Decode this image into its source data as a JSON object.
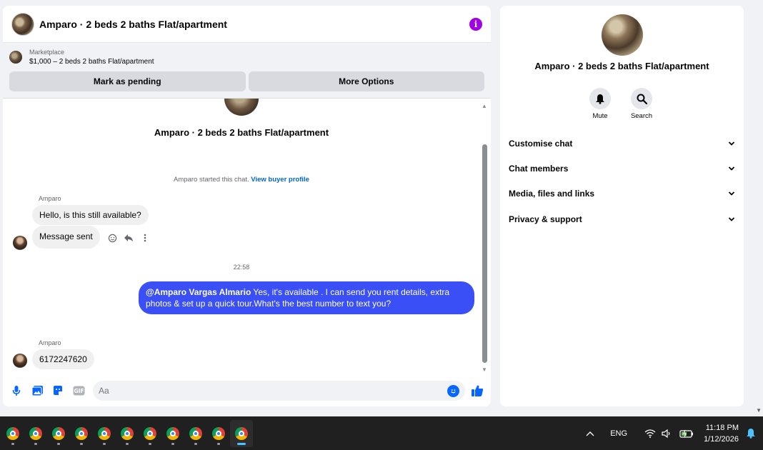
{
  "chat": {
    "title": "Amparo · 2 beds 2 baths Flat/apartment",
    "listing": {
      "label": "Marketplace",
      "detail": "$1,000 – 2 beds 2 baths Flat/apartment",
      "mark_pending": "Mark as pending",
      "more_options": "More Options"
    },
    "thread_name": "Amparo · 2 beds 2 baths Flat/apartment",
    "started_text": "Amparo started this chat.",
    "view_profile": "View buyer profile",
    "messages": [
      {
        "sender": "Amparo",
        "text": "Hello, is this still available?"
      },
      {
        "text": "Message sent"
      },
      {
        "timestamp": "22:58"
      },
      {
        "mention": "@Amparo Vargas Almario",
        "text": " Yes, it's available .  I can send you rent details, extra photos & set up a quick tour.What's the best number to text you?"
      },
      {
        "sender": "Amparo",
        "text": "6172247620"
      }
    ],
    "composer": {
      "placeholder": "Aa"
    }
  },
  "info_panel": {
    "name": "Amparo · 2 beds 2 baths Flat/apartment",
    "actions": [
      {
        "label": "Mute",
        "icon": "bell-icon"
      },
      {
        "label": "Search",
        "icon": "search-icon"
      }
    ],
    "sections": [
      "Customise chat",
      "Chat members",
      "Media, files and links",
      "Privacy & support"
    ]
  },
  "taskbar": {
    "app_count": 11,
    "language": "ENG",
    "time": "11:18 PM",
    "date": "1/12/2026"
  },
  "colors": {
    "accent": "#0866ff",
    "outgoing_bubble": "#3a4ff5",
    "info_icon": "#a001e6"
  }
}
